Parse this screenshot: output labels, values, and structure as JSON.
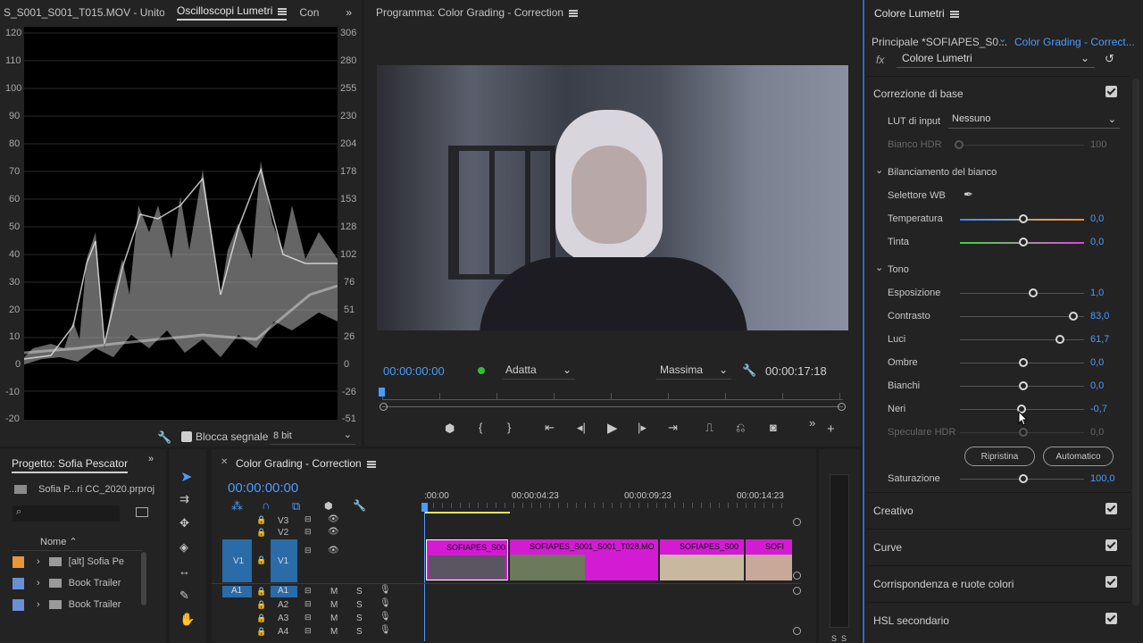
{
  "scopes": {
    "tabs": [
      "S_S001_S001_T015.MOV - Unito",
      "Oscilloscopi Lumetri",
      "Con"
    ],
    "left_scale": [
      "120",
      "110",
      "100",
      "90",
      "80",
      "70",
      "60",
      "50",
      "40",
      "30",
      "20",
      "10",
      "0",
      "-10",
      "-20"
    ],
    "right_scale": [
      "306",
      "280",
      "255",
      "230",
      "204",
      "178",
      "153",
      "128",
      "102",
      "76",
      "51",
      "26",
      "0",
      "-26",
      "-51"
    ],
    "clamp_label": "Blocca segnale",
    "bit_depth": "8 bit"
  },
  "program": {
    "title": "Programma: Color Grading - Correction",
    "timecode": "00:00:00:00",
    "fit": "Adatta",
    "quality": "Massima",
    "duration": "00:00:17:18"
  },
  "lumetri": {
    "title": "Colore Lumetri",
    "master": "Principale *SOFIAPES_S0...",
    "sequence": "Color Grading - Correct...",
    "fx_label": "fx",
    "effect": "Colore Lumetri",
    "basic": "Correzione di base",
    "lut_label": "LUT di input",
    "lut_value": "Nessuno",
    "hdr_white": "Bianco HDR",
    "hdr_white_value": "100",
    "wb": "Bilanciamento del bianco",
    "wb_selector": "Selettore WB",
    "temp": "Temperatura",
    "temp_value": "0,0",
    "tint": "Tinta",
    "tint_value": "0,0",
    "tone": "Tono",
    "exposure": "Esposizione",
    "exposure_value": "1,0",
    "contrast": "Contrasto",
    "contrast_value": "83,0",
    "highlights": "Luci",
    "highlights_value": "61,7",
    "shadows": "Ombre",
    "shadows_value": "0,0",
    "whites": "Bianchi",
    "whites_value": "0,0",
    "blacks": "Neri",
    "blacks_value": "-0,7",
    "hdr_spec": "Speculare HDR",
    "hdr_spec_value": "0,0",
    "reset": "Ripristina",
    "auto": "Automatico",
    "saturation": "Saturazione",
    "saturation_value": "100,0",
    "creative": "Creativo",
    "curves": "Curve",
    "color_match": "Corrispondenza e ruote colori",
    "hsl": "HSL secondario"
  },
  "project": {
    "title": "Progetto: Sofia Pescatori C",
    "file": "Sofia P...ri CC_2020.prproj",
    "col_name": "Nome",
    "items": [
      {
        "label": "[alt] Sofia Pe",
        "color": "#e8963a"
      },
      {
        "label": "Book Trailer",
        "color": "#6b8fd4"
      },
      {
        "label": "Book Trailer",
        "color": "#6b8fd4"
      }
    ]
  },
  "timeline": {
    "title": "Color Grading - Correction",
    "timecode": "00:00:00:00",
    "ruler": [
      ":00:00",
      "00:00:04:23",
      "00:00:09:23",
      "00:00:14:23"
    ],
    "tracks_video": [
      "V3",
      "V2",
      "V1"
    ],
    "tracks_audio": [
      "A1",
      "A2",
      "A3",
      "A4"
    ],
    "src_v1": "V1",
    "src_a1": "A1",
    "mute": "M",
    "solo": "S",
    "clips": [
      "SOFIAPES_S00",
      "SOFIAPES_S001_S001_T028.MO",
      "SOFIAPES_S00",
      "SOFI"
    ],
    "meter_labels": [
      "S",
      "S"
    ]
  }
}
